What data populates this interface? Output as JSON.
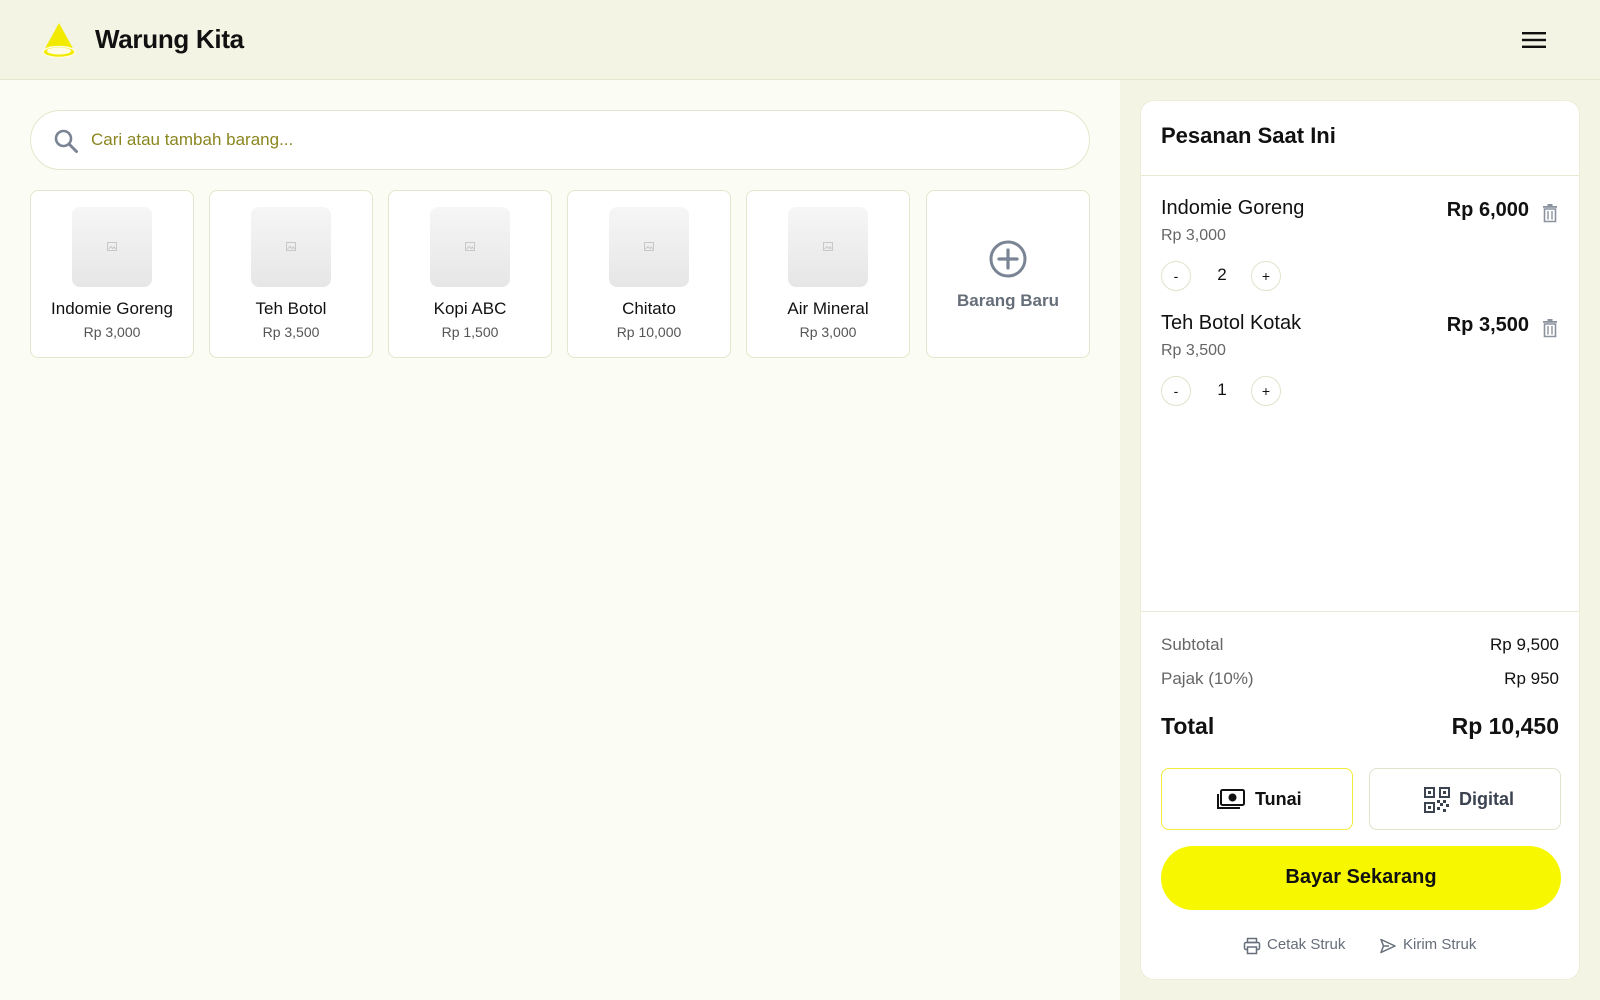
{
  "header": {
    "app_title": "Warung Kita",
    "logo_icon": "cone-logo-icon",
    "menu_icon": "hamburger-menu-icon"
  },
  "search": {
    "placeholder": "Cari atau tambah barang...",
    "icon": "search-icon"
  },
  "products": [
    {
      "name": "Indomie Goreng",
      "price": "Rp 3,000"
    },
    {
      "name": "Teh Botol",
      "price": "Rp 3,500"
    },
    {
      "name": "Kopi ABC",
      "price": "Rp 1,500"
    },
    {
      "name": "Chitato",
      "price": "Rp 10,000"
    },
    {
      "name": "Air Mineral",
      "price": "Rp 3,000"
    }
  ],
  "new_item": {
    "label": "Barang Baru",
    "icon": "plus-circle-icon"
  },
  "order": {
    "title": "Pesanan Saat Ini",
    "items": [
      {
        "name": "Indomie Goreng",
        "unit_price": "Rp 3,000",
        "total": "Rp 6,000",
        "qty": "2",
        "minus": "-",
        "plus": "+"
      },
      {
        "name": "Teh Botol Kotak",
        "unit_price": "Rp 3,500",
        "total": "Rp 3,500",
        "qty": "1",
        "minus": "-",
        "plus": "+"
      }
    ],
    "subtotal_label": "Subtotal",
    "subtotal_value": "Rp 9,500",
    "tax_label": "Pajak (10%)",
    "tax_value": "Rp 950",
    "total_label": "Total",
    "total_value": "Rp 10,450",
    "payment_methods": [
      {
        "label": "Tunai",
        "icon": "cash-icon",
        "selected": true
      },
      {
        "label": "Digital",
        "icon": "qr-code-icon",
        "selected": false
      }
    ],
    "pay_button": "Bayar Sekarang",
    "print_receipt": "Cetak Struk",
    "send_receipt": "Kirim Struk"
  },
  "colors": {
    "accent": "#f7f700",
    "header_bg": "#f3f4e4",
    "page_bg": "#fbfcf3",
    "placeholder": "#8a8620",
    "muted": "#666e7a"
  }
}
